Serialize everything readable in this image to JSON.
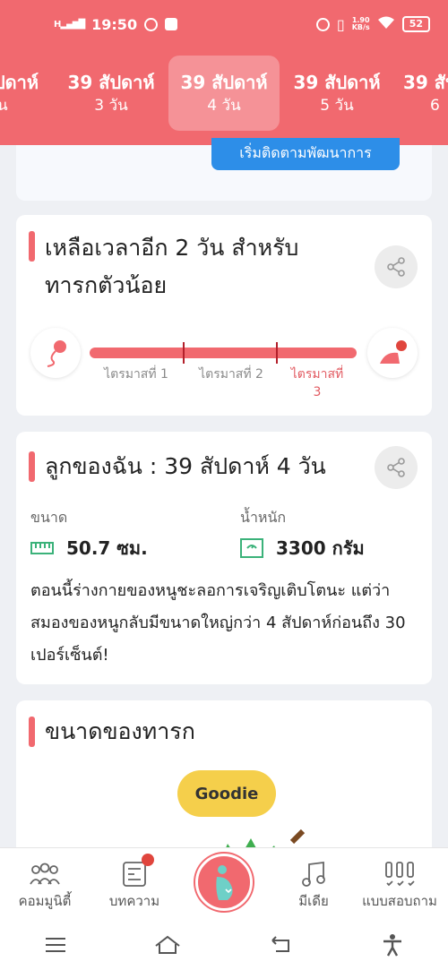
{
  "status_bar": {
    "network_label": "H",
    "time": "19:50",
    "net_speed": "1.90",
    "net_unit": "KB/s",
    "battery": "52"
  },
  "week_tabs": [
    {
      "l1": "ปดาห์",
      "l2": "วัน"
    },
    {
      "l1": "39 สัปดาห์",
      "l2": "3 วัน"
    },
    {
      "l1": "39 สัปดาห์",
      "l2": "4 วัน"
    },
    {
      "l1": "39 สัปดาห์",
      "l2": "5 วัน"
    },
    {
      "l1": "39 สัป",
      "l2": "6"
    }
  ],
  "top_card": {
    "cta_label": "เริ่มติดตามพัฒนาการ"
  },
  "remaining_card": {
    "title_line1": "เหลือเวลาอีก 2 วัน สำหรับ",
    "title_line2": "ทารกตัวน้อย",
    "trimester1": "ไตรมาสที่ 1",
    "trimester2": "ไตรมาสที่ 2",
    "trimester3_line1": "ไตรมาสที่",
    "trimester3_line2": "3",
    "progress_fraction": 0.995
  },
  "baby_card": {
    "title": "ลูกของฉัน : 39 สัปดาห์ 4  วัน",
    "size_label": "ขนาด",
    "weight_label": "น้ำหนัก",
    "size_value": "50.7 ซม.",
    "weight_value": "3300 กรัม",
    "description": "ตอนนี้ร่างกายของหนูชะลอการเจริญเติบโตนะ แต่ว่าสมองของหนูกลับมีขนาดใหญ่กว่า 4 สัปดาห์ก่อนถึง 30 เปอร์เซ็นต์!"
  },
  "size_card": {
    "title": "ขนาดของทารก",
    "goodie": "Goodie"
  },
  "bottom_nav": {
    "community": "คอมมูนิตี้",
    "articles": "บทความ",
    "media": "มีเดีย",
    "quiz": "แบบสอบถาม"
  },
  "colors": {
    "brand": "#f1696f",
    "cta": "#2d8ee8",
    "accent_dark": "#b3202b"
  }
}
